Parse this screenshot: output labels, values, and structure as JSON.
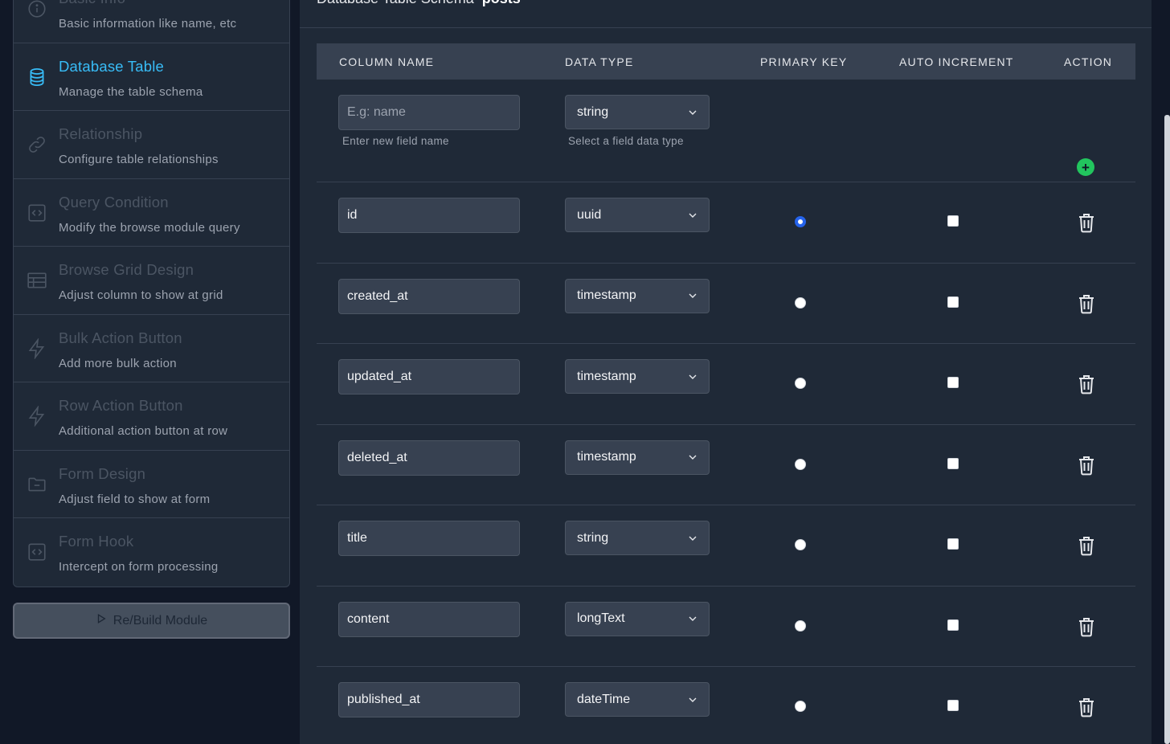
{
  "sidebar": {
    "steps": [
      {
        "title": "Basic Info",
        "desc": "Basic information like name, etc",
        "icon": "info-icon",
        "active": false
      },
      {
        "title": "Database Table",
        "desc": "Manage the table schema",
        "icon": "database-icon",
        "active": true
      },
      {
        "title": "Relationship",
        "desc": "Configure table relationships",
        "icon": "link-icon",
        "active": false
      },
      {
        "title": "Query Condition",
        "desc": "Modify the browse module query",
        "icon": "code-icon",
        "active": false
      },
      {
        "title": "Browse Grid Design",
        "desc": "Adjust column to show at grid",
        "icon": "table-icon",
        "active": false
      },
      {
        "title": "Bulk Action Button",
        "desc": "Add more bulk action",
        "icon": "lightning-icon",
        "active": false
      },
      {
        "title": "Row Action Button",
        "desc": "Additional action button at row",
        "icon": "lightning-icon",
        "active": false
      },
      {
        "title": "Form Design",
        "desc": "Adjust field to show at form",
        "icon": "folder-icon",
        "active": false
      },
      {
        "title": "Form Hook",
        "desc": "Intercept on form processing",
        "icon": "code-icon",
        "active": false
      }
    ],
    "rebuild_label": "Re/Build Module"
  },
  "main": {
    "title": "Database Table Schema",
    "table_name": "posts",
    "headers": {
      "column_name": "COLUMN NAME",
      "data_type": "DATA TYPE",
      "primary_key": "PRIMARY KEY",
      "auto_increment": "AUTO INCREMENT",
      "action": "ACTION"
    },
    "new_field": {
      "placeholder": "E.g: name",
      "type": "string",
      "name_help": "Enter new field name",
      "type_help": "Select a field data type"
    },
    "rows": [
      {
        "name": "id",
        "type": "uuid",
        "primary": true,
        "auto_increment": false
      },
      {
        "name": "created_at",
        "type": "timestamp",
        "primary": false,
        "auto_increment": false
      },
      {
        "name": "updated_at",
        "type": "timestamp",
        "primary": false,
        "auto_increment": false
      },
      {
        "name": "deleted_at",
        "type": "timestamp",
        "primary": false,
        "auto_increment": false
      },
      {
        "name": "title",
        "type": "string",
        "primary": false,
        "auto_increment": false
      },
      {
        "name": "content",
        "type": "longText",
        "primary": false,
        "auto_increment": false
      },
      {
        "name": "published_at",
        "type": "dateTime",
        "primary": false,
        "auto_increment": false
      }
    ]
  },
  "colors": {
    "accent": "#38bdf8",
    "add": "#22c55e",
    "radio_checked": "#2563eb"
  }
}
